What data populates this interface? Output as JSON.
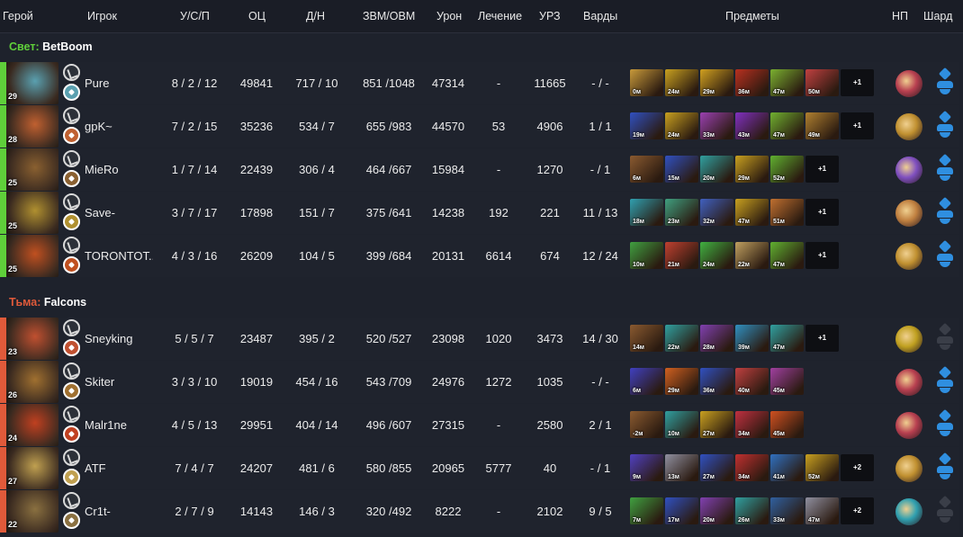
{
  "columns": {
    "hero": "Герой",
    "player": "Игрок",
    "kda": "У/С/П",
    "networth": "ОЦ",
    "lhdn": "Д/Н",
    "gpmxpm": "ЗВМ/ОВМ",
    "damage": "Урон",
    "healing": "Лечение",
    "building": "УРЗ",
    "wards": "Варды",
    "items": "Предметы",
    "np": "НП",
    "shard": "Шард"
  },
  "radiant": {
    "side": "Свет:",
    "name": "BetBoom",
    "color": "#5fcf3a",
    "players": [
      {
        "level": "29",
        "player": "Pure",
        "kda": "8 / 2 / 12",
        "networth": "49841",
        "lhdn": "717 / 10",
        "gpmxpm": "851 /1048",
        "damage": "47314",
        "healing": "-",
        "building": "11665",
        "wards": "- / -",
        "items": [
          {
            "t": "0м",
            "c": "#c89a3a"
          },
          {
            "t": "24м",
            "c": "#c8a020"
          },
          {
            "t": "29м",
            "c": "#d0a020"
          },
          {
            "t": "36м",
            "c": "#b83020"
          },
          {
            "t": "47м",
            "c": "#7ab030"
          },
          {
            "t": "50м",
            "c": "#c04040"
          }
        ],
        "more": "+1",
        "np_color": "#b84050",
        "shard": true
      },
      {
        "level": "28",
        "player": "gpK~",
        "kda": "7 / 2 / 15",
        "networth": "35236",
        "lhdn": "534 / 7",
        "gpmxpm": "655 /983",
        "damage": "44570",
        "healing": "53",
        "building": "4906",
        "wards": "1 / 1",
        "items": [
          {
            "t": "19м",
            "c": "#3050c0"
          },
          {
            "t": "24м",
            "c": "#c8a020"
          },
          {
            "t": "33м",
            "c": "#9a40b0"
          },
          {
            "t": "43м",
            "c": "#8030c0"
          },
          {
            "t": "47м",
            "c": "#70b030"
          },
          {
            "t": "49м",
            "c": "#b08030"
          }
        ],
        "more": "+1",
        "np_color": "#c09030",
        "shard": true
      },
      {
        "level": "25",
        "player": "MieRo",
        "kda": "1 / 7 / 14",
        "networth": "22439",
        "lhdn": "306 / 4",
        "gpmxpm": "464 /667",
        "damage": "15984",
        "healing": "-",
        "building": "1270",
        "wards": "- / 1",
        "items": [
          {
            "t": "6м",
            "c": "#8a5a30"
          },
          {
            "t": "15м",
            "c": "#3050c0"
          },
          {
            "t": "20м",
            "c": "#30a0a0"
          },
          {
            "t": "29м",
            "c": "#c8a020"
          },
          {
            "t": "52м",
            "c": "#60b030"
          }
        ],
        "more": "+1",
        "np_color": "#8050c0",
        "shard": true
      },
      {
        "level": "25",
        "player": "Save-",
        "kda": "3 / 7 / 17",
        "networth": "17898",
        "lhdn": "151 / 7",
        "gpmxpm": "375 /641",
        "damage": "14238",
        "healing": "192",
        "building": "221",
        "wards": "11 / 13",
        "items": [
          {
            "t": "18м",
            "c": "#30a0b0"
          },
          {
            "t": "23м",
            "c": "#40a080"
          },
          {
            "t": "32м",
            "c": "#4060c0"
          },
          {
            "t": "47м",
            "c": "#c8a020"
          },
          {
            "t": "51м",
            "c": "#c07030"
          }
        ],
        "more": "+1",
        "np_color": "#c08040",
        "shard": true
      },
      {
        "level": "25",
        "player": "TORONTOT...",
        "kda": "4 / 3 / 16",
        "networth": "26209",
        "lhdn": "104 / 5",
        "gpmxpm": "399 /684",
        "damage": "20131",
        "healing": "6614",
        "building": "674",
        "wards": "12 / 24",
        "items": [
          {
            "t": "10м",
            "c": "#40a040"
          },
          {
            "t": "21м",
            "c": "#c04030"
          },
          {
            "t": "24м",
            "c": "#40b040"
          },
          {
            "t": "22м",
            "c": "#c0a060"
          },
          {
            "t": "47м",
            "c": "#60b030"
          }
        ],
        "more": "+1",
        "np_color": "#c09030",
        "shard": true
      }
    ]
  },
  "dire": {
    "side": "Тьма:",
    "name": "Falcons",
    "color": "#e05a3a",
    "players": [
      {
        "level": "23",
        "player": "Sneyking",
        "kda": "5 / 5 / 7",
        "networth": "23487",
        "lhdn": "395 / 2",
        "gpmxpm": "520 /527",
        "damage": "23098",
        "healing": "1020",
        "building": "3473",
        "wards": "14 / 30",
        "items": [
          {
            "t": "14м",
            "c": "#8a5a30"
          },
          {
            "t": "22м",
            "c": "#30a0a0"
          },
          {
            "t": "28м",
            "c": "#8040b0"
          },
          {
            "t": "39м",
            "c": "#3090c0"
          },
          {
            "t": "47м",
            "c": "#30a0a0"
          }
        ],
        "more": "+1",
        "np_color": "#c0a020",
        "shard": false
      },
      {
        "level": "26",
        "player": "Skiter",
        "kda": "3 / 3 / 10",
        "networth": "19019",
        "lhdn": "454 / 16",
        "gpmxpm": "543 /709",
        "damage": "24976",
        "healing": "1272",
        "building": "1035",
        "wards": "- / -",
        "items": [
          {
            "t": "6м",
            "c": "#4040c0"
          },
          {
            "t": "29м",
            "c": "#d06020"
          },
          {
            "t": "36м",
            "c": "#3050c0"
          },
          {
            "t": "40м",
            "c": "#c04040"
          },
          {
            "t": "45м",
            "c": "#a040a0"
          }
        ],
        "more": "",
        "np_color": "#b84050",
        "shard": true
      },
      {
        "level": "24",
        "player": "Malr1ne",
        "kda": "4 / 5 / 13",
        "networth": "29951",
        "lhdn": "404 / 14",
        "gpmxpm": "496 /607",
        "damage": "27315",
        "healing": "-",
        "building": "2580",
        "wards": "2 / 1",
        "items": [
          {
            "t": "-2м",
            "c": "#8a5a30"
          },
          {
            "t": "10м",
            "c": "#30a0a0"
          },
          {
            "t": "27м",
            "c": "#c8a020"
          },
          {
            "t": "34м",
            "c": "#c03040"
          },
          {
            "t": "45м",
            "c": "#d05020"
          }
        ],
        "more": "",
        "np_color": "#b84050",
        "shard": true
      },
      {
        "level": "27",
        "player": "ATF",
        "kda": "7 / 4 / 7",
        "networth": "24207",
        "lhdn": "481 / 6",
        "gpmxpm": "580 /855",
        "damage": "20965",
        "healing": "5777",
        "building": "40",
        "wards": "- / 1",
        "items": [
          {
            "t": "9м",
            "c": "#5040c0"
          },
          {
            "t": "13м",
            "c": "#9090a0"
          },
          {
            "t": "27м",
            "c": "#3050c0"
          },
          {
            "t": "34м",
            "c": "#c03030"
          },
          {
            "t": "41м",
            "c": "#3070c0"
          },
          {
            "t": "52м",
            "c": "#c8a020"
          }
        ],
        "more": "+2",
        "np_color": "#c09030",
        "shard": true
      },
      {
        "level": "22",
        "player": "Cr1t-",
        "kda": "2 / 7 / 9",
        "networth": "14143",
        "lhdn": "146 / 3",
        "gpmxpm": "320 /492",
        "damage": "8222",
        "healing": "-",
        "building": "2102",
        "wards": "9 / 5",
        "items": [
          {
            "t": "7м",
            "c": "#40a040"
          },
          {
            "t": "17м",
            "c": "#3050c0"
          },
          {
            "t": "20м",
            "c": "#8040b0"
          },
          {
            "t": "26м",
            "c": "#30a0a0"
          },
          {
            "t": "33м",
            "c": "#3060a0"
          },
          {
            "t": "47м",
            "c": "#9090a0"
          }
        ],
        "more": "+2",
        "np_color": "#30a0b0",
        "shard": false
      }
    ]
  },
  "hero_colors": {
    "radiant": [
      "#5aa0b0",
      "#c06030",
      "#8a6030",
      "#b09030",
      "#c05020"
    ],
    "dire": [
      "#c05030",
      "#a07030",
      "#c04020",
      "#c0a050",
      "#8a7040"
    ]
  }
}
